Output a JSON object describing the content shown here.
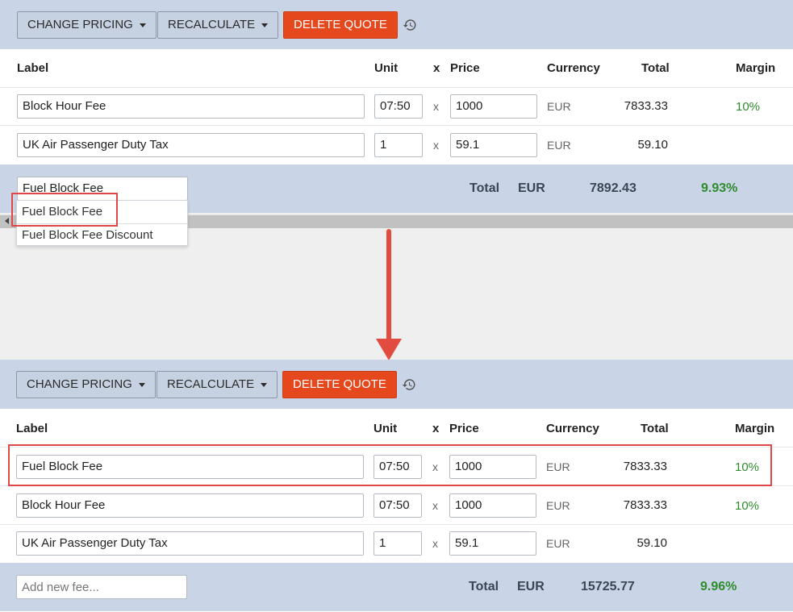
{
  "toolbar": {
    "change_pricing_label": "CHANGE PRICING",
    "recalculate_label": "RECALCULATE",
    "delete_quote_label": "DELETE QUOTE"
  },
  "columns": {
    "label": "Label",
    "unit": "Unit",
    "x": "x",
    "price": "Price",
    "currency": "Currency",
    "total": "Total",
    "margin": "Margin"
  },
  "top_panel": {
    "rows": [
      {
        "label": "Block Hour Fee",
        "unit": "07:50",
        "x": "x",
        "price": "1000",
        "currency": "EUR",
        "total": "7833.33",
        "margin": "10%"
      },
      {
        "label": "UK Air Passenger Duty Tax",
        "unit": "1",
        "x": "x",
        "price": "59.1",
        "currency": "EUR",
        "total": "59.10",
        "margin": ""
      }
    ],
    "fee_input_value": "Fuel Block Fee",
    "footer": {
      "total_label": "Total",
      "currency": "EUR",
      "total": "7892.43",
      "margin": "9.93%"
    },
    "dropdown_options": [
      "Fuel Block Fee",
      "Fuel Block Fee Discount"
    ]
  },
  "bottom_panel": {
    "rows": [
      {
        "label": "Fuel Block Fee",
        "unit": "07:50",
        "x": "x",
        "price": "1000",
        "currency": "EUR",
        "total": "7833.33",
        "margin": "10%"
      },
      {
        "label": "Block Hour Fee",
        "unit": "07:50",
        "x": "x",
        "price": "1000",
        "currency": "EUR",
        "total": "7833.33",
        "margin": "10%"
      },
      {
        "label": "UK Air Passenger Duty Tax",
        "unit": "1",
        "x": "x",
        "price": "59.1",
        "currency": "EUR",
        "total": "59.10",
        "margin": ""
      }
    ],
    "fee_input_placeholder": "Add new fee...",
    "footer": {
      "total_label": "Total",
      "currency": "EUR",
      "total": "15725.77",
      "margin": "9.96%"
    }
  },
  "colors": {
    "toolbar_bg": "#c9d5e6",
    "delete_button": "#e4481c",
    "margin_green": "#2e8b2e",
    "annotation_red": "#e24b3f"
  },
  "icons": {
    "history": "history-icon",
    "caret": "chevron-down-icon",
    "arrow": "arrow-down-annotation"
  }
}
